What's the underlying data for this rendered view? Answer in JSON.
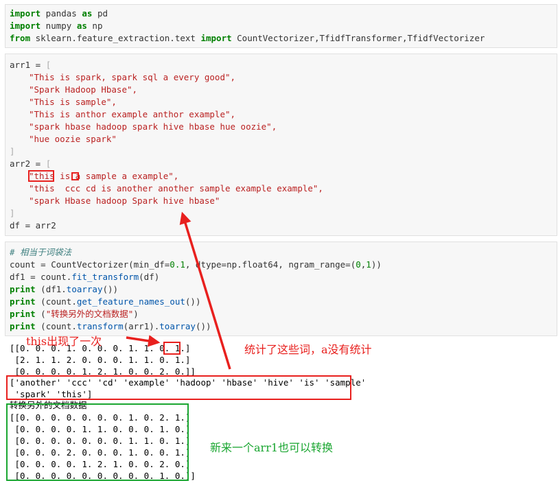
{
  "cell1": {
    "l1": {
      "k1": "import",
      "t1": " pandas ",
      "k2": "as",
      "t2": " pd"
    },
    "l2": {
      "k1": "import",
      "t1": " numpy ",
      "k2": "as",
      "t2": " np"
    },
    "l3": {
      "k1": "from",
      "t1": " sklearn.feature_extraction.text ",
      "k2": "import",
      "t2": " CountVectorizer,TfidfTransformer,TfidfVectorizer"
    }
  },
  "cell2": {
    "arr1_open": {
      "a": "arr1 = ",
      "b": "["
    },
    "arr1": [
      "\"This is spark, spark sql a every good\",",
      "\"Spark Hadoop Hbase\",",
      "\"This is sample\",",
      "\"This is anthor example anthor example\",",
      "\"spark hbase hadoop spark hive hbase hue oozie\",",
      "\"hue oozie spark\""
    ],
    "arr1_close": "]",
    "arr2_open": {
      "a": "arr2 = ",
      "b": "["
    },
    "arr2_first": {
      "a": "\"this",
      "b": " is ",
      "c": "a",
      "d": " sample a example\","
    },
    "arr2_rest": [
      "\"this  ccc cd is another another sample example example\",",
      "\"spark Hbase hadoop Spark hive hbase\""
    ],
    "arr2_close": "]",
    "df_line": "df = arr2"
  },
  "cell3": {
    "comment": "# 相当于词袋法",
    "l2": {
      "a": "count = CountVectorizer(min_df=",
      "b": "0.1",
      ",c": "",
      "c": ", dtype=np.float64, ngram_range=(",
      "d": "0",
      "e": ",",
      "f": "1",
      "g": "))"
    },
    "l3": {
      "a": "df1 = count.",
      "b": "fit_transform",
      "c": "(df)"
    },
    "l4": {
      "a": "print",
      "b": " (df1.",
      "c": "toarray",
      "d": "())"
    },
    "l5": {
      "a": "print",
      "b": " (count.",
      "c": "get_feature_names_out",
      "d": "())"
    },
    "l6": {
      "a": "print",
      "b": " (",
      "c": "\"转换另外的文档数据\"",
      "d": ")"
    },
    "l7": {
      "a": "print",
      "b": " (count.",
      "c": "transform",
      "d": "(arr1).",
      "e": "toarray",
      "f": "())"
    }
  },
  "output": {
    "matrix1": [
      "[[0. 0. 0. 1. 0. 0. 0. 1. 1. 0. 1.]",
      " [2. 1. 1. 2. 0. 0. 0. 1. 1. 0. 1.]",
      " [0. 0. 0. 0. 1. 2. 1. 0. 0. 2. 0.]]"
    ],
    "features": [
      "['another' 'ccc' 'cd' 'example' 'hadoop' 'hbase' 'hive' 'is' 'sample'",
      " 'spark' 'this']"
    ],
    "message": "转换另外的文档数据",
    "matrix2": [
      "[[0. 0. 0. 0. 0. 0. 0. 1. 0. 2. 1.]",
      " [0. 0. 0. 0. 1. 1. 0. 0. 0. 1. 0.]",
      " [0. 0. 0. 0. 0. 0. 0. 1. 1. 0. 1.]",
      " [0. 0. 0. 2. 0. 0. 0. 1. 0. 0. 1.]",
      " [0. 0. 0. 0. 1. 2. 1. 0. 0. 2. 0.]",
      " [0. 0. 0. 0. 0. 0. 0. 0. 0. 1. 0.]]"
    ]
  },
  "annotations": {
    "this_appeared_once": "this出现了一次",
    "counted_words": "统计了这些词，a没有统计",
    "new_arr1": "新来一个arr1也可以转换"
  },
  "colors": {
    "red": "#e8201e",
    "green": "#1aa631",
    "keyword": "#008000",
    "string": "#ba2121",
    "function": "#0055aa"
  }
}
